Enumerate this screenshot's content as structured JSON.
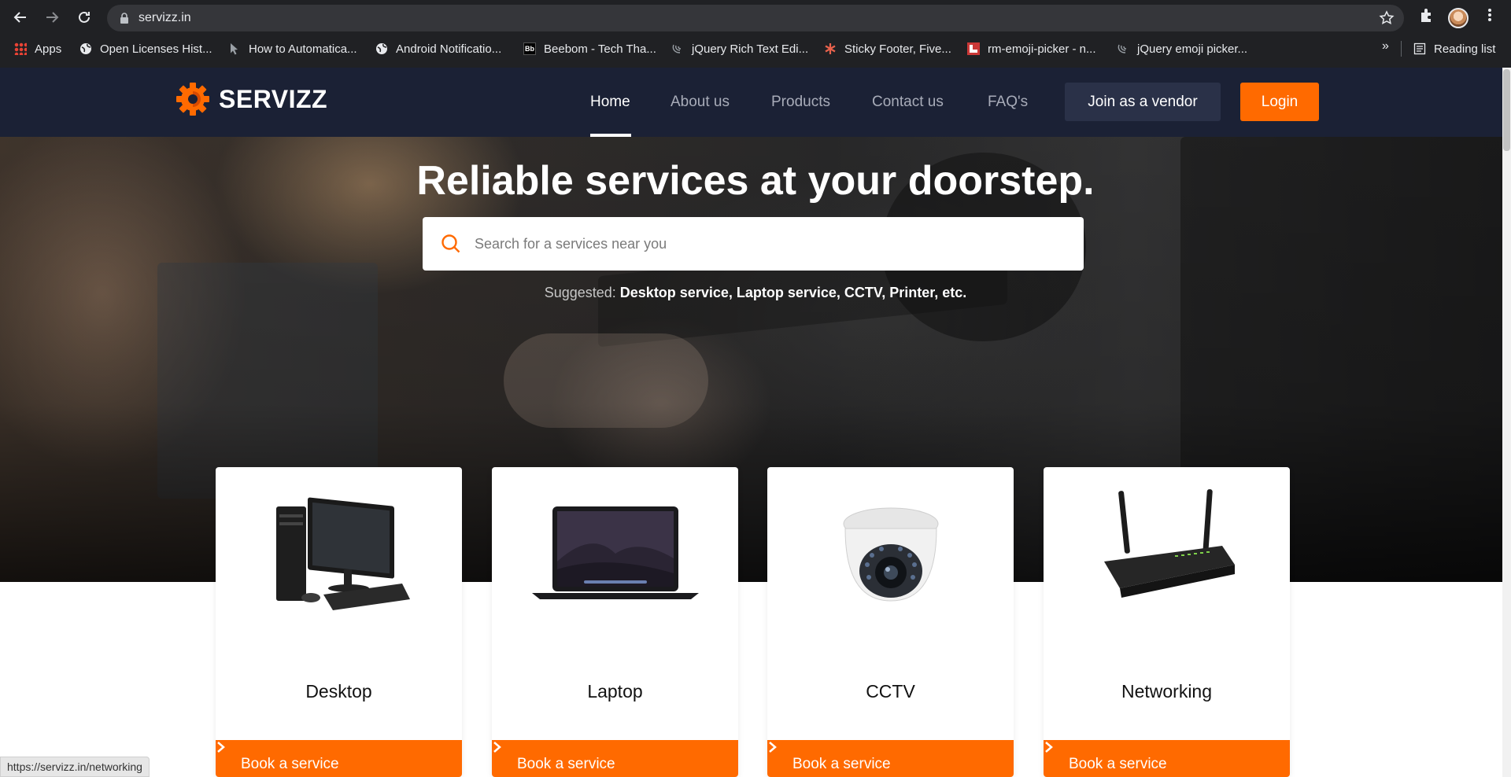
{
  "browser": {
    "url": "servizz.in",
    "bookmarks": [
      {
        "label": "Apps",
        "icon": "apps-grid-icon"
      },
      {
        "label": "Open Licenses Hist...",
        "icon": "globe-icon"
      },
      {
        "label": "How to Automatica...",
        "icon": "cursor-icon"
      },
      {
        "label": "Android Notificatio...",
        "icon": "globe-icon"
      },
      {
        "label": "Beebom - Tech Tha...",
        "icon": "beebom-icon"
      },
      {
        "label": "jQuery Rich Text Edi...",
        "icon": "jquery-icon"
      },
      {
        "label": "Sticky Footer, Five...",
        "icon": "asterisk-icon"
      },
      {
        "label": "rm-emoji-picker - n...",
        "icon": "npm-icon"
      },
      {
        "label": "jQuery emoji picker...",
        "icon": "jquery-icon"
      }
    ],
    "more_bookmarks": "»",
    "reading_list": "Reading list",
    "status_url": "https://servizz.in/networking"
  },
  "site": {
    "brand": "SERVIZZ",
    "nav": [
      "Home",
      "About us",
      "Products",
      "Contact us",
      "FAQ's"
    ],
    "vendor_button": "Join as a vendor",
    "login_button": "Login",
    "accent_color": "#ff6a00",
    "header_color": "#1b2135"
  },
  "hero": {
    "title": "Reliable services at your doorstep.",
    "search_placeholder": "Search for a services near you",
    "suggested_label": "Suggested:",
    "suggested_items": "Desktop service, Laptop service, CCTV, Printer, etc."
  },
  "services": [
    {
      "name": "Desktop",
      "cta": "Book a service",
      "icon": "desktop-computer-icon"
    },
    {
      "name": "Laptop",
      "cta": "Book a service",
      "icon": "laptop-icon"
    },
    {
      "name": "CCTV",
      "cta": "Book a service",
      "icon": "cctv-camera-icon"
    },
    {
      "name": "Networking",
      "cta": "Book a service",
      "icon": "router-icon"
    }
  ]
}
